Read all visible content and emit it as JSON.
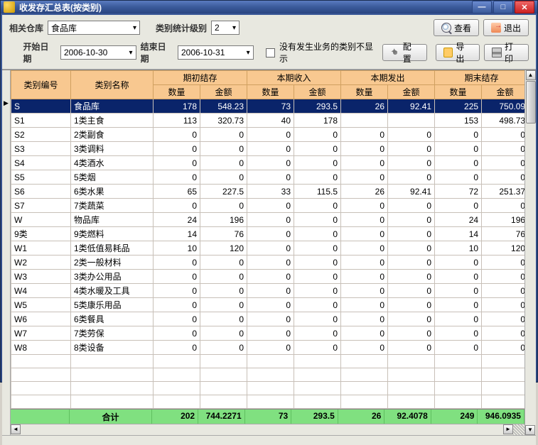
{
  "window": {
    "title": "收发存汇总表(按类别)"
  },
  "toolbar": {
    "warehouse_label": "相关仓库",
    "warehouse_value": "食品库",
    "level_label": "类别统计级别",
    "level_value": "2",
    "start_label": "开始日期",
    "start_value": "2006-10-30",
    "end_label": "结束日期",
    "end_value": "2006-10-31",
    "hide_empty_label": "没有发生业务的类别不显示",
    "view_label": "查看",
    "exit_label": "退出",
    "config_label": "配置",
    "export_label": "导出",
    "print_label": "打印"
  },
  "columns": {
    "code": "类别编号",
    "name": "类别名称",
    "group_begin": "期初结存",
    "group_in": "本期收入",
    "group_out": "本期发出",
    "group_end": "期末结存",
    "qty": "数量",
    "amt": "金额"
  },
  "rows": [
    {
      "code": "S",
      "name": "食品库",
      "bq": "178",
      "ba": "548.23",
      "iq": "73",
      "ia": "293.5",
      "oq": "26",
      "oa": "92.41",
      "eq": "225",
      "ea": "750.09",
      "sel": true
    },
    {
      "code": "S1",
      "name": "1类主食",
      "bq": "113",
      "ba": "320.73",
      "iq": "40",
      "ia": "178",
      "oq": "",
      "oa": "",
      "eq": "153",
      "ea": "498.73"
    },
    {
      "code": "S2",
      "name": "2类副食",
      "bq": "0",
      "ba": "0",
      "iq": "0",
      "ia": "0",
      "oq": "0",
      "oa": "0",
      "eq": "0",
      "ea": "0"
    },
    {
      "code": "S3",
      "name": "3类调料",
      "bq": "0",
      "ba": "0",
      "iq": "0",
      "ia": "0",
      "oq": "0",
      "oa": "0",
      "eq": "0",
      "ea": "0"
    },
    {
      "code": "S4",
      "name": "4类酒水",
      "bq": "0",
      "ba": "0",
      "iq": "0",
      "ia": "0",
      "oq": "0",
      "oa": "0",
      "eq": "0",
      "ea": "0"
    },
    {
      "code": "S5",
      "name": "5类烟",
      "bq": "0",
      "ba": "0",
      "iq": "0",
      "ia": "0",
      "oq": "0",
      "oa": "0",
      "eq": "0",
      "ea": "0"
    },
    {
      "code": "S6",
      "name": "6类水果",
      "bq": "65",
      "ba": "227.5",
      "iq": "33",
      "ia": "115.5",
      "oq": "26",
      "oa": "92.41",
      "eq": "72",
      "ea": "251.37"
    },
    {
      "code": "S7",
      "name": "7类蔬菜",
      "bq": "0",
      "ba": "0",
      "iq": "0",
      "ia": "0",
      "oq": "0",
      "oa": "0",
      "eq": "0",
      "ea": "0"
    },
    {
      "code": "W",
      "name": "物品库",
      "bq": "24",
      "ba": "196",
      "iq": "0",
      "ia": "0",
      "oq": "0",
      "oa": "0",
      "eq": "24",
      "ea": "196"
    },
    {
      "code": "9类",
      "name": "9类燃料",
      "bq": "14",
      "ba": "76",
      "iq": "0",
      "ia": "0",
      "oq": "0",
      "oa": "0",
      "eq": "14",
      "ea": "76"
    },
    {
      "code": "W1",
      "name": "1类低值易耗品",
      "bq": "10",
      "ba": "120",
      "iq": "0",
      "ia": "0",
      "oq": "0",
      "oa": "0",
      "eq": "10",
      "ea": "120"
    },
    {
      "code": "W2",
      "name": "2类一般材料",
      "bq": "0",
      "ba": "0",
      "iq": "0",
      "ia": "0",
      "oq": "0",
      "oa": "0",
      "eq": "0",
      "ea": "0"
    },
    {
      "code": "W3",
      "name": "3类办公用品",
      "bq": "0",
      "ba": "0",
      "iq": "0",
      "ia": "0",
      "oq": "0",
      "oa": "0",
      "eq": "0",
      "ea": "0"
    },
    {
      "code": "W4",
      "name": "4类水暖及工具",
      "bq": "0",
      "ba": "0",
      "iq": "0",
      "ia": "0",
      "oq": "0",
      "oa": "0",
      "eq": "0",
      "ea": "0"
    },
    {
      "code": "W5",
      "name": "5类康乐用品",
      "bq": "0",
      "ba": "0",
      "iq": "0",
      "ia": "0",
      "oq": "0",
      "oa": "0",
      "eq": "0",
      "ea": "0"
    },
    {
      "code": "W6",
      "name": "6类餐具",
      "bq": "0",
      "ba": "0",
      "iq": "0",
      "ia": "0",
      "oq": "0",
      "oa": "0",
      "eq": "0",
      "ea": "0"
    },
    {
      "code": "W7",
      "name": "7类劳保",
      "bq": "0",
      "ba": "0",
      "iq": "0",
      "ia": "0",
      "oq": "0",
      "oa": "0",
      "eq": "0",
      "ea": "0"
    },
    {
      "code": "W8",
      "name": "8类设备",
      "bq": "0",
      "ba": "0",
      "iq": "0",
      "ia": "0",
      "oq": "0",
      "oa": "0",
      "eq": "0",
      "ea": "0"
    }
  ],
  "totals": {
    "label": "合计",
    "bq": "202",
    "ba": "744.2271",
    "iq": "73",
    "ia": "293.5",
    "oq": "26",
    "oa": "92.4078",
    "eq": "249",
    "ea": "946.0935"
  },
  "col_widths": {
    "code": 84,
    "name": 116,
    "cell": 66
  }
}
